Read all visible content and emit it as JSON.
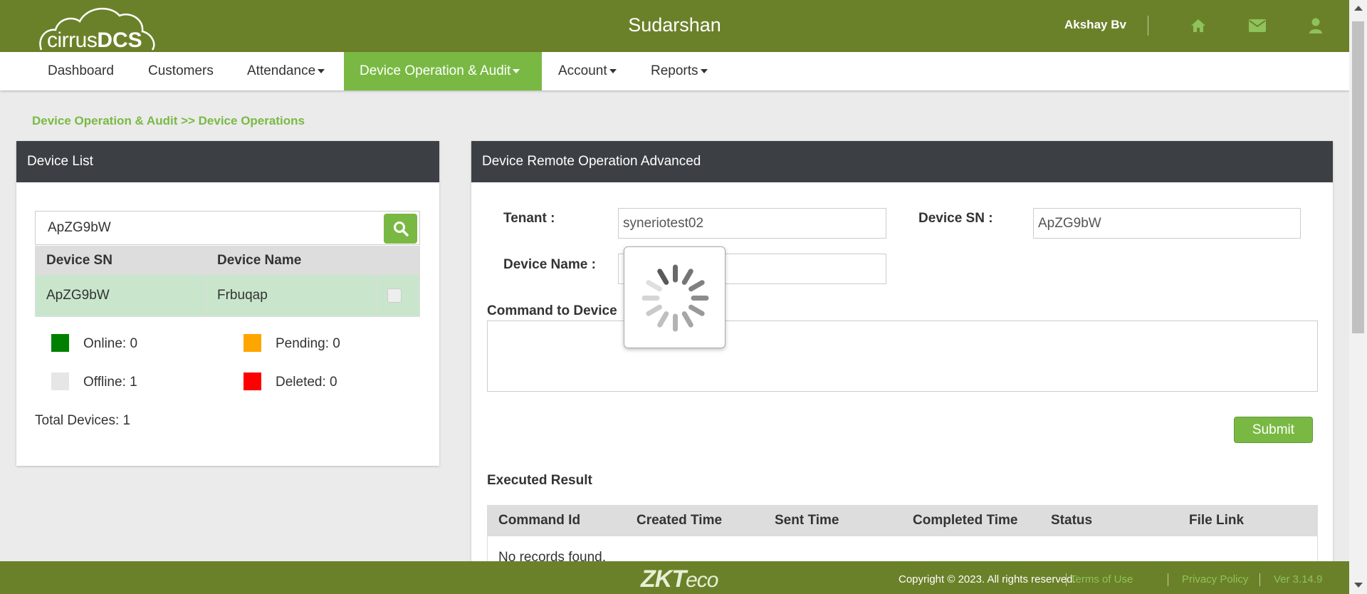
{
  "header": {
    "logo_text_light": "cirrus",
    "logo_text_bold": "DCS",
    "title": "Sudarshan",
    "user_name": "Akshay Bv",
    "icons": [
      "home-icon",
      "mail-icon",
      "user-icon"
    ]
  },
  "nav": {
    "items": [
      {
        "label": "Dashboard"
      },
      {
        "label": "Customers"
      },
      {
        "label": "Attendance"
      },
      {
        "label": "Device Operation & Audit"
      },
      {
        "label": "Account"
      },
      {
        "label": "Reports"
      }
    ],
    "active_index": 3
  },
  "breadcrumb": "Device Operation & Audit >> Device Operations",
  "device_list": {
    "title": "Device List",
    "search_value": "ApZG9bW",
    "columns": [
      "Device SN",
      "Device Name",
      ""
    ],
    "rows": [
      {
        "sn": "ApZG9bW",
        "name": "Frbuqap",
        "checked": false
      }
    ],
    "legend": [
      {
        "label": "Online: 0",
        "color": "#008000"
      },
      {
        "label": "Pending: 0",
        "color": "#ffa500"
      },
      {
        "label": "Offline: 1",
        "color": "#e6e6e6"
      },
      {
        "label": "Deleted: 0",
        "color": "#ff0000"
      }
    ],
    "total": "Total Devices: 1"
  },
  "remote_op": {
    "title": "Device Remote Operation Advanced",
    "tenant_label": "Tenant :",
    "tenant_value": "syneriotest02",
    "device_sn_label": "Device SN :",
    "device_sn_value": "ApZG9bW",
    "device_name_label": "Device Name :",
    "device_name_value": "",
    "command_label": "Command to Device",
    "command_value": "",
    "submit_label": "Submit",
    "executed_result_label": "Executed Result",
    "result_columns": [
      "Command Id",
      "Created Time",
      "Sent Time",
      "Completed Time",
      "Status",
      "File Link"
    ],
    "empty_message": "No records found."
  },
  "footer": {
    "logo_bold": "ZKT",
    "logo_light": "eco",
    "copyright": "Copyright © 2023. All rights reserved.",
    "terms": "Terms of Use",
    "privacy": "Privacy Policy",
    "version": "Ver 3.14.9"
  },
  "colors": {
    "brand_green": "#6b8129",
    "accent_green": "#79b943",
    "panel_header": "#3c4044"
  }
}
